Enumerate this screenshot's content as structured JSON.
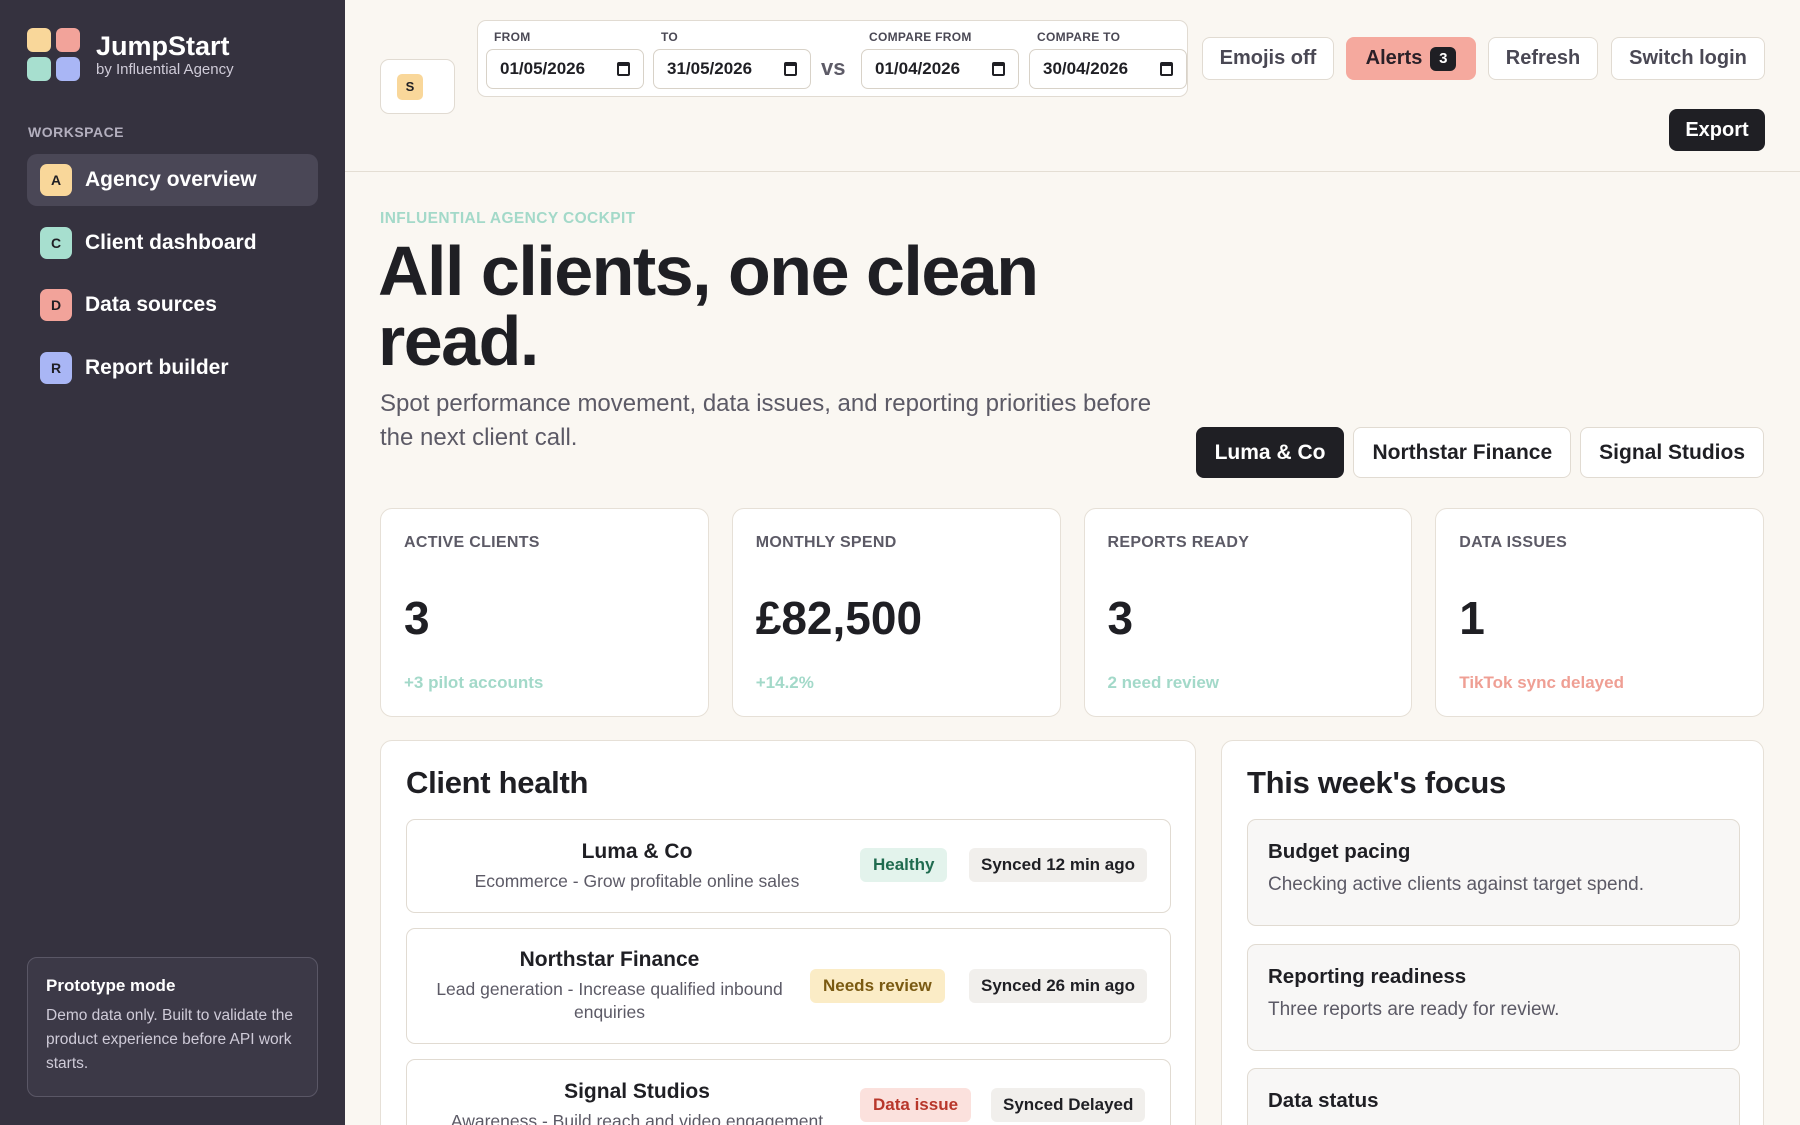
{
  "brand": {
    "name": "JumpStart",
    "sub": "by Influential Agency"
  },
  "sidebar": {
    "section": "WORKSPACE",
    "items": [
      {
        "letter": "A",
        "label": "Agency overview",
        "color": "#f9d79a",
        "active": true
      },
      {
        "letter": "C",
        "label": "Client dashboard",
        "color": "#a7dfcf"
      },
      {
        "letter": "D",
        "label": "Data sources",
        "color": "#f2a39a"
      },
      {
        "letter": "R",
        "label": "Report builder",
        "color": "#a9b6f5"
      }
    ],
    "prototype": {
      "title": "Prototype mode",
      "text": "Demo data only. Built to validate the product experience before API work starts."
    }
  },
  "topbar": {
    "avatar": "S",
    "from": {
      "label": "FROM",
      "value": "01/05/2026"
    },
    "to": {
      "label": "TO",
      "value": "31/05/2026"
    },
    "vs": "vs",
    "compare_from": {
      "label": "COMPARE FROM",
      "value": "01/04/2026"
    },
    "compare_to": {
      "label": "COMPARE TO",
      "value": "30/04/2026"
    },
    "emojis": "Emojis off",
    "alerts": "Alerts",
    "alerts_count": "3",
    "refresh": "Refresh",
    "switch_login": "Switch login",
    "export": "Export"
  },
  "hero": {
    "eyebrow": "INFLUENTIAL AGENCY COCKPIT",
    "title": "All clients, one clean read.",
    "subtitle": "Spot performance movement, data issues, and reporting priorities before the next client call."
  },
  "client_tabs": [
    "Luma & Co",
    "Northstar Finance",
    "Signal Studios"
  ],
  "stats": [
    {
      "label": "ACTIVE CLIENTS",
      "value": "3",
      "note": "+3 pilot accounts",
      "note_color": "#a3d9c9"
    },
    {
      "label": "MONTHLY SPEND",
      "value": "£82,500",
      "note": "+14.2%",
      "note_color": "#a3d9c9"
    },
    {
      "label": "REPORTS READY",
      "value": "3",
      "note": "2 need review",
      "note_color": "#a3d9c9"
    },
    {
      "label": "DATA ISSUES",
      "value": "1",
      "note": "TikTok sync delayed",
      "note_color": "#ef9f94"
    }
  ],
  "health": {
    "title": "Client health",
    "rows": [
      {
        "name": "Luma & Co",
        "desc": "Ecommerce - Grow profitable online sales",
        "status": "Healthy",
        "sync": "Synced 12 min ago"
      },
      {
        "name": "Northstar Finance",
        "desc": "Lead generation - Increase qualified inbound enquiries",
        "status": "Needs review",
        "sync": "Synced 26 min ago"
      },
      {
        "name": "Signal Studios",
        "desc": "Awareness - Build reach and video engagement",
        "status": "Data issue",
        "sync": "Synced Delayed"
      }
    ]
  },
  "focus": {
    "title": "This week's focus",
    "cards": [
      {
        "title": "Budget pacing",
        "text": "Checking active clients against target spend."
      },
      {
        "title": "Reporting readiness",
        "text": "Three reports are ready for review."
      },
      {
        "title": "Data status",
        "text": ""
      }
    ]
  },
  "colors": {
    "sidebar_bg": "#35323f",
    "healthy_bg": "#e3f3ec",
    "healthy_fg": "#1f6b4f",
    "review_bg": "#fbecc6",
    "review_fg": "#7a5a12",
    "issue_bg": "#fbe1dd",
    "issue_fg": "#b8372b"
  }
}
